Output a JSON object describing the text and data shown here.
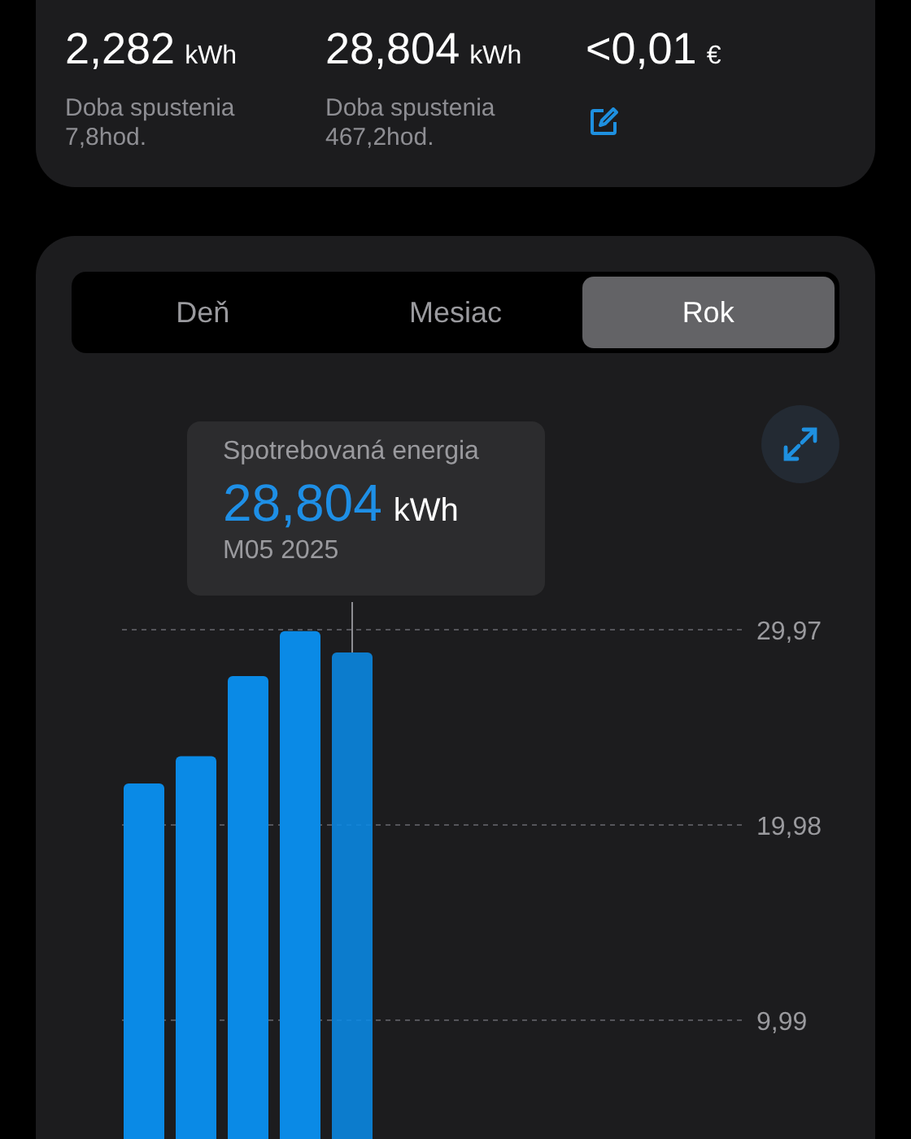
{
  "summary": [
    {
      "value": "2,282",
      "unit": "kWh",
      "label": "Doba spustenia",
      "detail": "7,8hod.",
      "kind": "runtime"
    },
    {
      "value": "28,804",
      "unit": "kWh",
      "label": "Doba spustenia",
      "detail": "467,2hod.",
      "kind": "runtime"
    },
    {
      "value": "<0,01",
      "unit": "€",
      "kind": "cost"
    }
  ],
  "tabs": [
    {
      "label": "Deň",
      "selected": false
    },
    {
      "label": "Mesiac",
      "selected": false
    },
    {
      "label": "Rok",
      "selected": true
    }
  ],
  "tooltip": {
    "title": "Spotrebovaná energia",
    "value": "28,804",
    "unit": "kWh",
    "period": "M05 2025"
  },
  "chart_data": {
    "type": "bar",
    "grid": true,
    "ylim": [
      0,
      29.97
    ],
    "yticks": [
      {
        "value": 9.99,
        "label": "9,99"
      },
      {
        "value": 19.98,
        "label": "19,98"
      },
      {
        "value": 29.97,
        "label": "29,97"
      }
    ],
    "values": [
      22.1,
      23.5,
      27.6,
      29.9,
      28.8,
      null,
      null,
      null,
      null,
      null,
      null,
      null
    ]
  }
}
